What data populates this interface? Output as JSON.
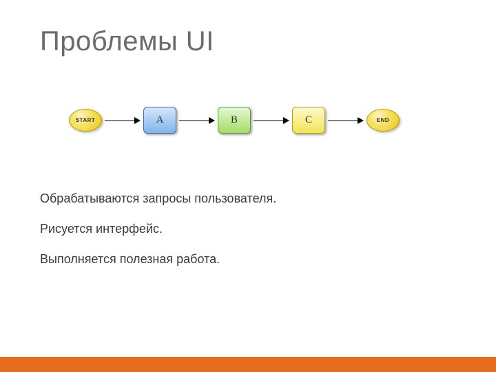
{
  "title": "Проблемы UI",
  "flow": {
    "start": "START",
    "a": "A",
    "b": "B",
    "c": "C",
    "end": "END"
  },
  "body": {
    "line1": "Обрабатываются запросы пользователя.",
    "line2": "Рисуется интерфейс.",
    "line3": "Выполняется полезная работа."
  }
}
